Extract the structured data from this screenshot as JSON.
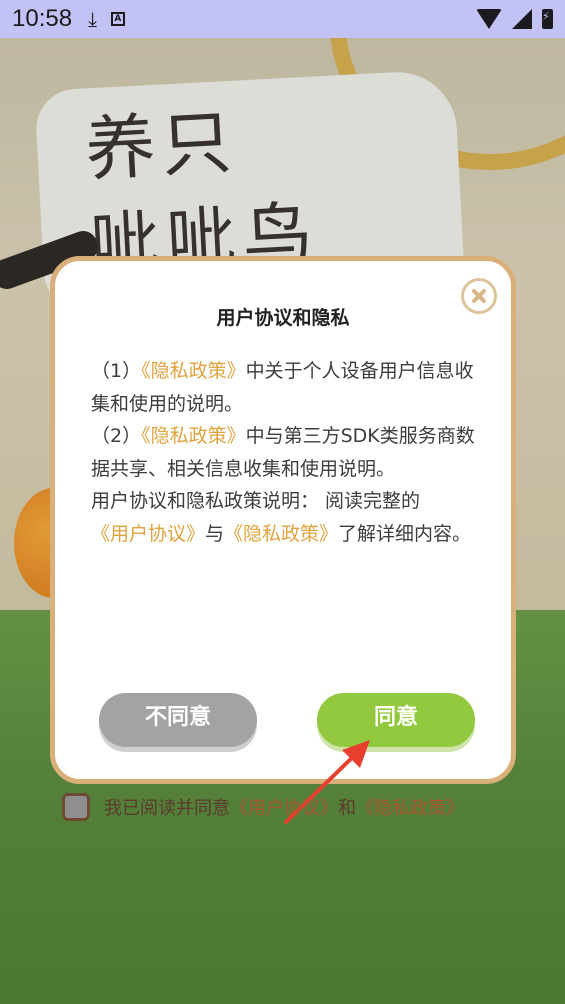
{
  "status_bar": {
    "time": "10:58",
    "icons": [
      "download-icon",
      "a-badge-icon",
      "wifi-icon",
      "cell-signal-icon",
      "battery-charging-icon"
    ],
    "badge_letter": "A"
  },
  "background": {
    "sign_line1": "养只",
    "sign_line2": "呲呲鸟"
  },
  "dialog": {
    "title": "用户协议和隐私",
    "item1_prefix": "（1）",
    "item1_link": "《隐私政策》",
    "item1_text": "中关于个人设备用户信息收集和使用的说明。",
    "item2_prefix": "（2）",
    "item2_link": "《隐私政策》",
    "item2_text": "中与第三方SDK类服务商数据共享、相关信息收集和使用说明。",
    "summary_text": "用户协议和隐私政策说明： 阅读完整的",
    "summary_link1": "《用户协议》",
    "summary_join": "与",
    "summary_link2": "《隐私政策》",
    "summary_end": "了解详细内容。",
    "disagree_label": "不同意",
    "agree_label": "同意"
  },
  "consent": {
    "text": "我已阅读并同意",
    "link1": "《用户协议》",
    "join": "和",
    "link2": "《隐私政策》",
    "checked": false
  },
  "colors": {
    "link": "#e0a33d",
    "agree_button": "#92c93e",
    "disagree_button": "#a3a3a3",
    "dialog_border": "#d9b07a",
    "status_bar": "#c3c2f5",
    "arrow": "#e8402f"
  }
}
